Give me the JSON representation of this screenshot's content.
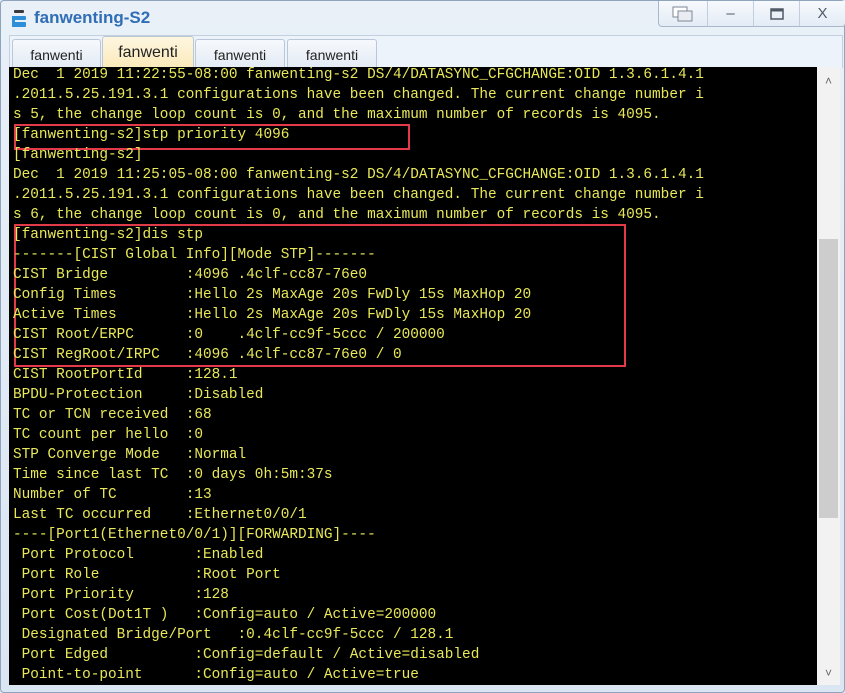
{
  "window": {
    "title": "fanwenting-S2",
    "icon": "network-device-icon",
    "controls": {
      "restore_icon": "restore-windows-icon",
      "minimize_label": "–",
      "maximize_label": "▭",
      "close_label": "X"
    }
  },
  "tabs": [
    {
      "label": "fanwenti",
      "active": false
    },
    {
      "label": "fanwenti",
      "active": true
    },
    {
      "label": "fanwenti",
      "active": false
    },
    {
      "label": "fanwenti",
      "active": false
    }
  ],
  "terminal": {
    "colors": {
      "background": "#000000",
      "text": "#e8e85a",
      "highlight_box": "#e23a48"
    },
    "lines": [
      "Dec  1 2019 11:22:55-08:00 fanwenting-s2 DS/4/DATASYNC_CFGCHANGE:OID 1.3.6.1.4.1",
      ".2011.5.25.191.3.1 configurations have been changed. The current change number i",
      "s 5, the change loop count is 0, and the maximum number of records is 4095.",
      "[fanwenting-s2]stp priority 4096",
      "[fanwenting-s2]",
      "Dec  1 2019 11:25:05-08:00 fanwenting-s2 DS/4/DATASYNC_CFGCHANGE:OID 1.3.6.1.4.1",
      ".2011.5.25.191.3.1 configurations have been changed. The current change number i",
      "s 6, the change loop count is 0, and the maximum number of records is 4095.",
      "[fanwenting-s2]dis stp",
      "-------[CIST Global Info][Mode STP]-------",
      "CIST Bridge         :4096 .4clf-cc87-76e0",
      "Config Times        :Hello 2s MaxAge 20s FwDly 15s MaxHop 20",
      "Active Times        :Hello 2s MaxAge 20s FwDly 15s MaxHop 20",
      "CIST Root/ERPC      :0    .4clf-cc9f-5ccc / 200000",
      "CIST RegRoot/IRPC   :4096 .4clf-cc87-76e0 / 0",
      "CIST RootPortId     :128.1",
      "BPDU-Protection     :Disabled",
      "TC or TCN received  :68",
      "TC count per hello  :0",
      "STP Converge Mode   :Normal",
      "Time since last TC  :0 days 0h:5m:37s",
      "Number of TC        :13",
      "Last TC occurred    :Ethernet0/0/1",
      "----[Port1(Ethernet0/0/1)][FORWARDING]----",
      " Port Protocol       :Enabled",
      " Port Role           :Root Port",
      " Port Priority       :128",
      " Port Cost(Dot1T )   :Config=auto / Active=200000",
      " Designated Bridge/Port   :0.4clf-cc9f-5ccc / 128.1",
      " Port Edged          :Config=default / Active=disabled",
      " Point-to-point      :Config=auto / Active=true"
    ]
  },
  "scrollbar": {
    "up_icon": "˄",
    "down_icon": "˅",
    "thumb_start_fraction": 0.26,
    "thumb_size_fraction": 0.49
  }
}
